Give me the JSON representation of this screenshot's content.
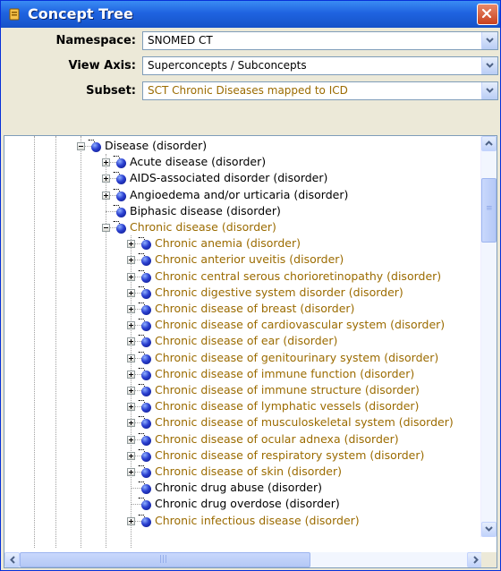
{
  "window": {
    "title": "Concept Tree"
  },
  "fields": [
    {
      "label": "Namespace:",
      "value": "SNOMED CT",
      "style": "black"
    },
    {
      "label": "View Axis:",
      "value": "Superconcepts / Subconcepts",
      "style": "black"
    },
    {
      "label": "Subset:",
      "value": "SCT Chronic Diseases mapped to ICD",
      "style": "gold"
    }
  ],
  "tree": {
    "nodes": [
      {
        "label": "Disease (disorder)",
        "level": 0,
        "expander": "minus",
        "style": "black"
      },
      {
        "label": "Acute disease (disorder)",
        "level": 1,
        "expander": "plus",
        "style": "black"
      },
      {
        "label": "AIDS-associated disorder (disorder)",
        "level": 1,
        "expander": "plus",
        "style": "black"
      },
      {
        "label": "Angioedema and/or urticaria (disorder)",
        "level": 1,
        "expander": "plus",
        "style": "black"
      },
      {
        "label": "Biphasic disease (disorder)",
        "level": 1,
        "expander": "none",
        "style": "black"
      },
      {
        "label": "Chronic disease (disorder)",
        "level": 1,
        "expander": "minus",
        "style": "gold"
      },
      {
        "label": "Chronic anemia (disorder)",
        "level": 2,
        "expander": "plus",
        "style": "gold"
      },
      {
        "label": "Chronic anterior uveitis (disorder)",
        "level": 2,
        "expander": "plus",
        "style": "gold"
      },
      {
        "label": "Chronic central serous chorioretinopathy (disorder)",
        "level": 2,
        "expander": "plus",
        "style": "gold"
      },
      {
        "label": "Chronic digestive system disorder (disorder)",
        "level": 2,
        "expander": "plus",
        "style": "gold"
      },
      {
        "label": "Chronic disease of breast (disorder)",
        "level": 2,
        "expander": "plus",
        "style": "gold"
      },
      {
        "label": "Chronic disease of cardiovascular system (disorder)",
        "level": 2,
        "expander": "plus",
        "style": "gold"
      },
      {
        "label": "Chronic disease of ear (disorder)",
        "level": 2,
        "expander": "plus",
        "style": "gold"
      },
      {
        "label": "Chronic disease of genitourinary system (disorder)",
        "level": 2,
        "expander": "plus",
        "style": "gold"
      },
      {
        "label": "Chronic disease of immune function (disorder)",
        "level": 2,
        "expander": "plus",
        "style": "gold"
      },
      {
        "label": "Chronic disease of immune structure (disorder)",
        "level": 2,
        "expander": "plus",
        "style": "gold"
      },
      {
        "label": "Chronic disease of lymphatic vessels (disorder)",
        "level": 2,
        "expander": "plus",
        "style": "gold"
      },
      {
        "label": "Chronic disease of musculoskeletal system (disorder)",
        "level": 2,
        "expander": "plus",
        "style": "gold"
      },
      {
        "label": "Chronic disease of ocular adnexa (disorder)",
        "level": 2,
        "expander": "plus",
        "style": "gold"
      },
      {
        "label": "Chronic disease of respiratory system (disorder)",
        "level": 2,
        "expander": "plus",
        "style": "gold"
      },
      {
        "label": "Chronic disease of skin (disorder)",
        "level": 2,
        "expander": "plus",
        "style": "gold"
      },
      {
        "label": "Chronic drug abuse (disorder)",
        "level": 2,
        "expander": "none",
        "style": "black"
      },
      {
        "label": "Chronic drug overdose (disorder)",
        "level": 2,
        "expander": "none",
        "style": "black"
      },
      {
        "label": "Chronic infectious disease (disorder)",
        "level": 2,
        "expander": "plus",
        "style": "gold"
      }
    ]
  },
  "scrollbars": {
    "vertical_position": 0.1,
    "horizontal_position": 0.0
  },
  "colors": {
    "titlebar": "#1f63e0",
    "gold_text": "#9b6b00",
    "black_text": "#000000"
  },
  "icons": {
    "title": "app-icon",
    "close": "close-icon",
    "node": "concept-node-icon"
  }
}
